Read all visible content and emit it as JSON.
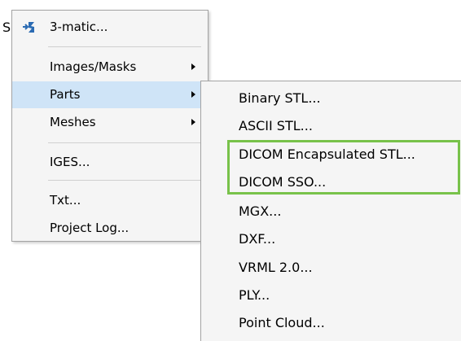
{
  "app": {
    "edge_char": "S"
  },
  "main_menu": {
    "items": [
      {
        "name": "menu-item-3matic",
        "label": "3-matic...",
        "has_submenu": false,
        "icon": "3matic-icon"
      },
      {
        "name": "menu-item-images-masks",
        "label": "Images/Masks",
        "has_submenu": true
      },
      {
        "name": "menu-item-parts",
        "label": "Parts",
        "has_submenu": true,
        "highlighted": true
      },
      {
        "name": "menu-item-meshes",
        "label": "Meshes",
        "has_submenu": true
      },
      {
        "name": "menu-item-iges",
        "label": "IGES...",
        "has_submenu": false
      },
      {
        "name": "menu-item-txt",
        "label": "Txt...",
        "has_submenu": false
      },
      {
        "name": "menu-item-project-log",
        "label": "Project Log...",
        "has_submenu": false
      }
    ]
  },
  "parts_submenu": {
    "items": [
      {
        "name": "submenu-item-binary-stl",
        "label": "Binary STL..."
      },
      {
        "name": "submenu-item-ascii-stl",
        "label": "ASCII STL..."
      },
      {
        "name": "submenu-item-dicom-encapsulated-stl",
        "label": "DICOM Encapsulated STL...",
        "boxed": true
      },
      {
        "name": "submenu-item-dicom-sso",
        "label": "DICOM SSO...",
        "boxed": true
      },
      {
        "name": "submenu-item-mgx",
        "label": "MGX..."
      },
      {
        "name": "submenu-item-dxf",
        "label": "DXF..."
      },
      {
        "name": "submenu-item-vrml",
        "label": "VRML 2.0..."
      },
      {
        "name": "submenu-item-ply",
        "label": "PLY..."
      },
      {
        "name": "submenu-item-point-cloud",
        "label": "Point Cloud..."
      }
    ]
  },
  "colors": {
    "menu_background": "#f5f5f5",
    "hover_highlight": "#cfe4f7",
    "annotation_box": "#78c24a",
    "icon_blue": "#2b6bb3"
  }
}
